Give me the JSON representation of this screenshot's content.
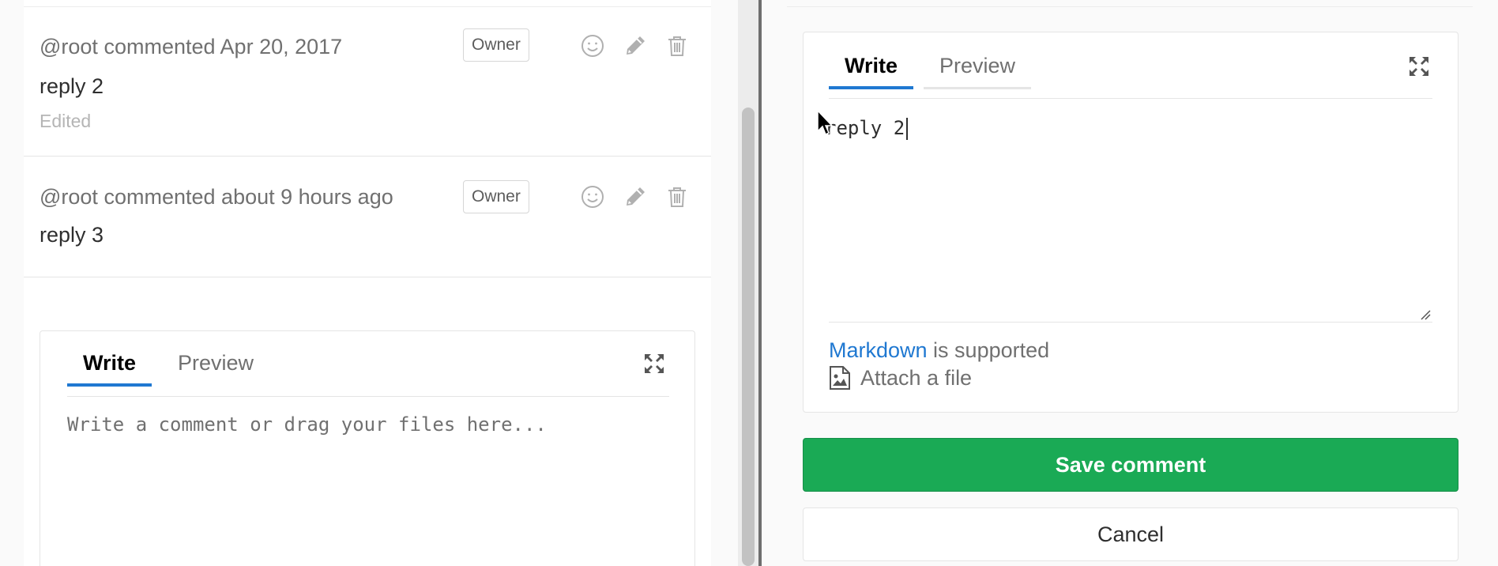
{
  "notes": [
    {
      "author": "@root",
      "action": "commented",
      "time": "Apr 20, 2017",
      "badge": "Owner",
      "body": "reply 2",
      "edited": "Edited"
    },
    {
      "author": "@root",
      "action": "commented",
      "time": "about 9 hours ago",
      "badge": "Owner",
      "body": "reply 3"
    }
  ],
  "new_comment_form": {
    "tab_write": "Write",
    "tab_preview": "Preview",
    "placeholder": "Write a comment or drag your files here..."
  },
  "edit_form": {
    "tab_write": "Write",
    "tab_preview": "Preview",
    "text": "reply 2",
    "markdown_link": "Markdown",
    "markdown_suffix": " is supported",
    "attach_label": "Attach a file",
    "save_label": "Save comment",
    "cancel_label": "Cancel"
  },
  "colors": {
    "accent": "#1f78d1",
    "save_green": "#1aaa55",
    "muted_text": "#707070"
  },
  "icons": [
    "emoji-icon",
    "pencil-icon",
    "trash-icon",
    "fullscreen-icon",
    "image-icon",
    "mouse-cursor-icon"
  ]
}
